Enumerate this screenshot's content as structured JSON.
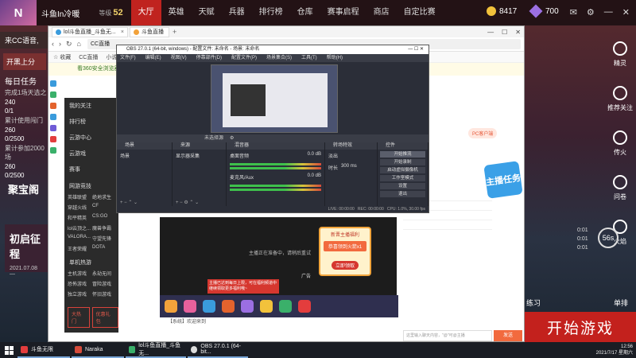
{
  "game": {
    "player_name": "斗鱼In冷暖",
    "rank_label": "等级",
    "rank_value": "52",
    "nav": [
      "大厅",
      "英雄",
      "天赋",
      "兵器",
      "排行榜",
      "仓库",
      "赛事启程",
      "商店",
      "自定比赛"
    ],
    "active_nav": "大厅",
    "coins": "8417",
    "gems": "700",
    "voice_label": "来CC语音,",
    "box_label": "开黑上分",
    "task_title": "每日任务",
    "task_line": "完成1场天选之",
    "task_rewards": [
      "240",
      "0/1",
      "累计使用闯门",
      "260",
      "0/2500",
      "累计参加2000场",
      "260",
      "0/2500"
    ],
    "bao_ge": "聚宝阁",
    "chu_qi_title": "初启征程",
    "chu_qi_date": "2021.07.08—",
    "right_items": [
      "精灵",
      "推荐关注",
      "传火",
      "问卷",
      "火焰"
    ],
    "timer": "56s",
    "train_label": "练习",
    "dual_label": "单排",
    "start_button": "开始游戏"
  },
  "browser": {
    "tab_title": "lol斗鱼直播_斗鱼无...",
    "tab_title_2": "斗鱼直播",
    "url": "CC直播",
    "bookmarks": [
      "☆ 收藏",
      "CC直播",
      "小说阅读"
    ],
    "infobar": "看360安全浏览器",
    "sidebar_menu": [
      "我的关注",
      "排行榜",
      "云游中心",
      "云游戏",
      "赛事",
      "网游竞技"
    ],
    "games": [
      "英雄联盟",
      "绝地求生",
      "穿越火线",
      "CF",
      "和平精英",
      "CS:GO",
      "lol云顶之...",
      "魔兽争霸",
      "VALORA...",
      "守望先锋",
      "王者荣耀",
      "DOTA"
    ],
    "section": "单机热游",
    "section_games": [
      "主机游戏",
      "永劫无间",
      "恐怖游戏",
      "冒险游戏",
      "独立游戏",
      "怀旧游戏"
    ],
    "btn_hot": "大热门",
    "btn_buy": "优惠礼包",
    "stream_text": "主播正在准备中，请稍后重试",
    "ad_label": "广告",
    "popup_title": "新晋主播福利",
    "popup_main": "恭喜领到火箭x1",
    "popup_btn": "立即领取",
    "promo_text": "主播已达到每日上限，可在福利频道中继续领取更多福利哦~",
    "chat_row": "【系统】欢迎来到",
    "rc_tag": "PC客户端",
    "rc_promo": "主播任务",
    "rc_input": "这里输入聊天内容，\"@\"可@主播",
    "rc_send": "发送"
  },
  "obs": {
    "title": "OBS 27.0.1 (64-bit, windows) - 配置文件: 未命名 - 场景: 未命名",
    "menu": [
      "文件(F)",
      "编辑(E)",
      "视图(V)",
      "停靠部件(D)",
      "配置文件(P)",
      "场景集合(S)",
      "工具(T)",
      "帮助(H)"
    ],
    "dock_scene": "场景",
    "dock_source": "来源",
    "dock_mixer": "混音器",
    "dock_transition": "转场特效",
    "dock_controls": "控件",
    "scene_item": "场景",
    "source_item": "显示器采集",
    "mixer_items": [
      "桌面音频",
      "麦克风/Aux"
    ],
    "mixer_db": [
      "0.0 dB",
      "0.0 dB"
    ],
    "transition_value": "淡出",
    "duration_label": "时长",
    "duration_value": "300 ms",
    "controls": [
      "开始推流",
      "开始录制",
      "启动虚拟摄像机",
      "工作室模式",
      "设置",
      "退出"
    ],
    "status": [
      "LIVE: 00:00:00",
      "REC: 00:00:00",
      "CPU: 1.0%, 30.00 fps"
    ],
    "hint": "未选择源"
  },
  "taskbar": {
    "apps": [
      "斗鱼无限",
      "Naraka",
      "lol斗鱼直播_斗鱼无...",
      "OBS 27.0.1 (64-bit..."
    ],
    "time": "12:56",
    "date": "2021/7/17 星期六"
  }
}
